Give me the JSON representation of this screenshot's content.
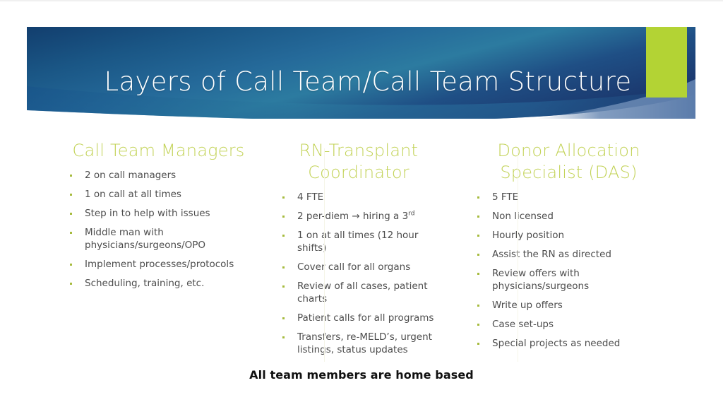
{
  "slide": {
    "title": "Layers of Call Team/Call Team Structure",
    "footer_note": "All team members are home based"
  },
  "theme": {
    "accent_green": "#b3d334",
    "heading_green": "#c3d359",
    "bullet_green": "#a6bb3e",
    "banner_navy": "#123e6e",
    "banner_teal": "#2c7ba0",
    "banner_right_navy": "#1b3a70",
    "banner_swoosh": "#5b7cab",
    "body_text": "#4d4d4d",
    "divider": "#f5f5e8",
    "footer_text": "#111111"
  },
  "columns": [
    {
      "heading": "Call Team Managers",
      "bullets": [
        "2 on call managers",
        "1 on call at all times",
        "Step in to help with issues",
        "Middle man with physicians/surgeons/OPO",
        "Implement processes/protocols",
        "Scheduling, training, etc."
      ]
    },
    {
      "heading": "RN-Transplant Coordinator",
      "bullets": [
        "4 FTE",
        "2 per-diem → hiring a 3",
        "1 on at all times (12 hour shifts)",
        "Cover call for all organs",
        "Review of all cases, patient charts",
        "Patient calls for all programs",
        "Transfers, re-MELD’s, urgent listings, status updates"
      ],
      "bullet_2_superscript": "rd"
    },
    {
      "heading": "Donor Allocation Specialist (DAS)",
      "bullets": [
        "5 FTE",
        "Non licensed",
        "Hourly position",
        "Assist the RN as directed",
        "Review offers with physicians/surgeons",
        "Write up offers",
        "Case set-ups",
        "Special projects as needed"
      ]
    }
  ]
}
